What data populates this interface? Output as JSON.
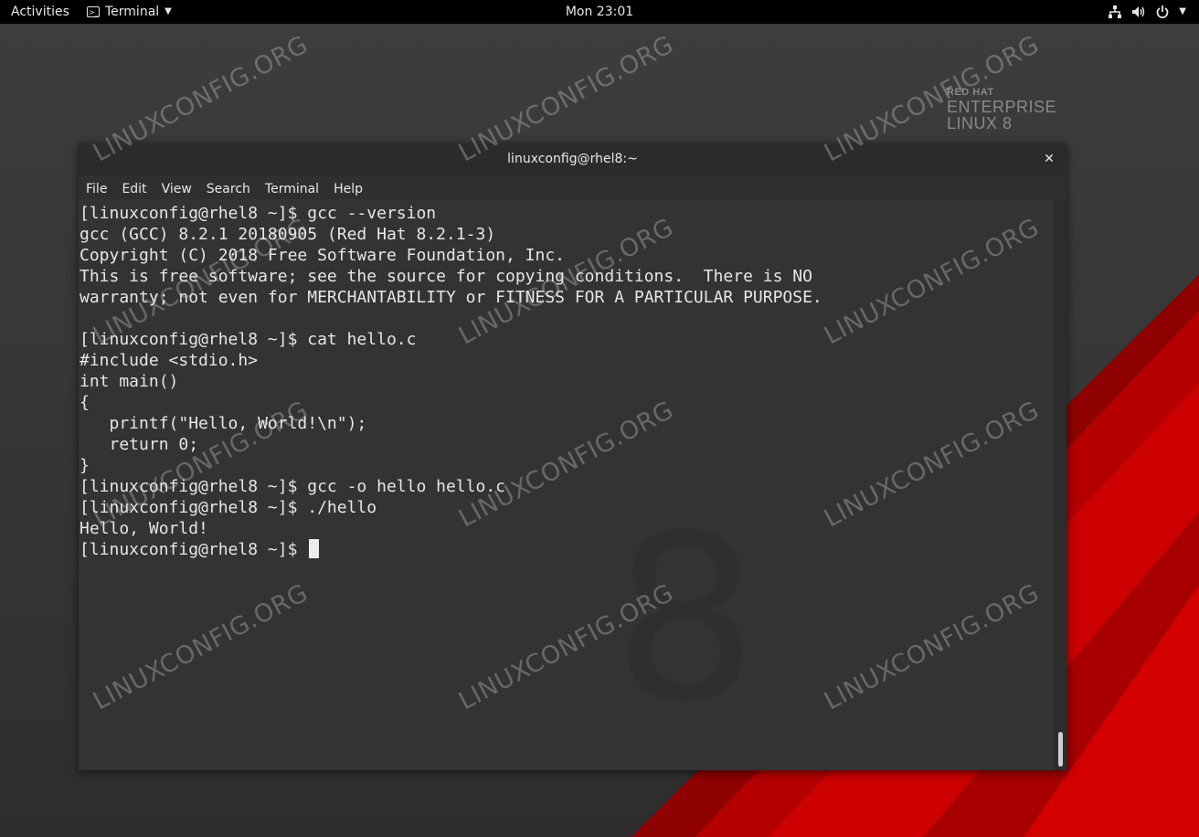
{
  "topbar": {
    "activities_label": "Activities",
    "app_menu_label": "Terminal",
    "clock": "Mon 23:01",
    "icons": [
      "network-icon",
      "volume-icon",
      "power-icon",
      "chevron-down-icon"
    ]
  },
  "background": {
    "logo": [
      "RED HAT",
      "ENTERPRISE",
      "LINUX 8"
    ],
    "watermark_text": "LINUXCONFIG.ORG",
    "colors": {
      "red": "#c40000",
      "dark": "#3a3838"
    }
  },
  "window": {
    "title": "linuxconfig@rhel8:~",
    "close_icon": "close-icon",
    "menu": [
      "File",
      "Edit",
      "View",
      "Search",
      "Terminal",
      "Help"
    ]
  },
  "terminal": {
    "lines": [
      "[linuxconfig@rhel8 ~]$ gcc --version",
      "gcc (GCC) 8.2.1 20180905 (Red Hat 8.2.1-3)",
      "Copyright (C) 2018 Free Software Foundation, Inc.",
      "This is free software; see the source for copying conditions.  There is NO",
      "warranty; not even for MERCHANTABILITY or FITNESS FOR A PARTICULAR PURPOSE.",
      "",
      "[linuxconfig@rhel8 ~]$ cat hello.c",
      "#include <stdio.h>",
      "int main()",
      "{",
      "   printf(\"Hello, World!\\n\");",
      "   return 0;",
      "}",
      "[linuxconfig@rhel8 ~]$ gcc -o hello hello.c",
      "[linuxconfig@rhel8 ~]$ ./hello",
      "Hello, World!"
    ],
    "prompt": "[linuxconfig@rhel8 ~]$ "
  }
}
